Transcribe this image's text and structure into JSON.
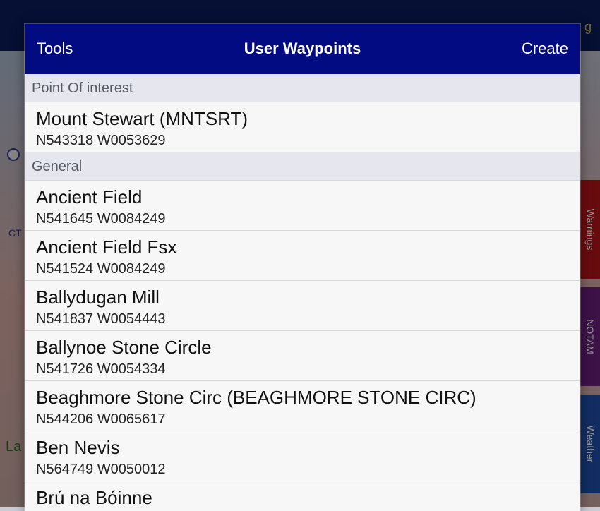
{
  "background": {
    "top_label": "g",
    "map_letter": "La",
    "map_code": "CT",
    "side_tabs": [
      "Warnings",
      "NOTAM",
      "Weather"
    ],
    "side_tab_colors": [
      "#b3131b",
      "#6a1f7a",
      "#1f4fa8"
    ]
  },
  "navbar": {
    "left_label": "Tools",
    "title": "User Waypoints",
    "right_label": "Create"
  },
  "sections": [
    {
      "header": "Point Of interest",
      "items": [
        {
          "name": "Mount Stewart (MNTSRT)",
          "coords": "N543318 W0053629"
        }
      ]
    },
    {
      "header": "General",
      "items": [
        {
          "name": "Ancient Field",
          "coords": "N541645 W0084249"
        },
        {
          "name": "Ancient Field Fsx",
          "coords": "N541524 W0084249"
        },
        {
          "name": "Ballydugan Mill",
          "coords": "N541837 W0054443"
        },
        {
          "name": "Ballynoe Stone Circle",
          "coords": "N541726 W0054334"
        },
        {
          "name": "Beaghmore Stone Circ (BEAGHMORE STONE CIRC)",
          "coords": "N544206 W0065617"
        },
        {
          "name": "Ben Nevis",
          "coords": "N564749 W0050012"
        },
        {
          "name": "Brú na Bóinne",
          "coords": ""
        }
      ]
    }
  ]
}
